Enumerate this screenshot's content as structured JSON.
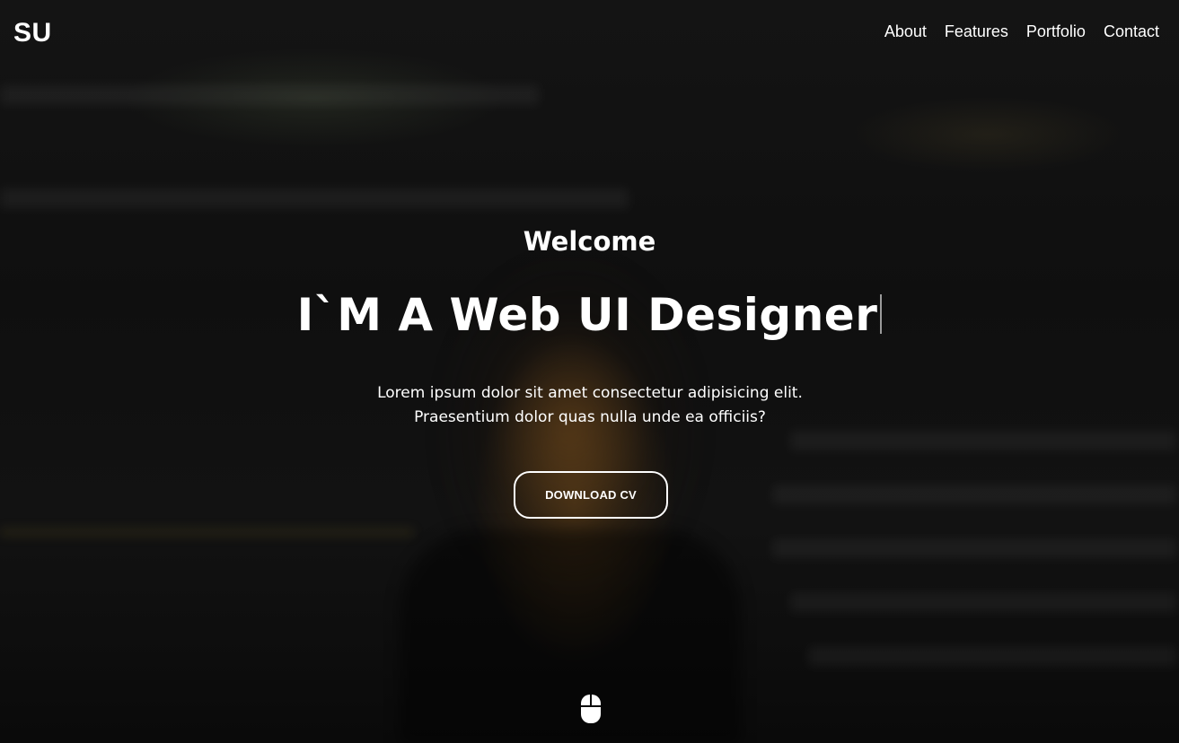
{
  "brand": {
    "logo_text": "SU"
  },
  "nav": {
    "items": [
      {
        "label": "About"
      },
      {
        "label": "Features"
      },
      {
        "label": "Portfolio"
      },
      {
        "label": "Contact"
      }
    ]
  },
  "hero": {
    "greeting": "Welcome",
    "headline": "I`M A Web UI Designer",
    "description": "Lorem ipsum dolor sit amet consectetur adipisicing elit. Praesentium dolor quas nulla unde ea officiis?",
    "cta_label": "DOWNLOAD CV",
    "scroll_icon": "mouse-icon"
  },
  "colors": {
    "text": "#ffffff",
    "background": "#0b0b0b",
    "cursor": "#9a9a9a"
  }
}
